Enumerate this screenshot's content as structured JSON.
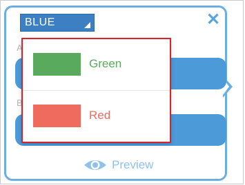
{
  "select": {
    "value": "BLUE"
  },
  "hidden_labels": {
    "first": "A",
    "second": "B"
  },
  "dropdown": {
    "options": [
      {
        "label": "Green",
        "swatch_color": "#5aaa5d",
        "text_color": "#5aaa5d"
      },
      {
        "label": "Red",
        "swatch_color": "#ee6b5e",
        "text_color": "#ee6b5e"
      }
    ]
  },
  "footer": {
    "preview_label": "Preview"
  },
  "colors": {
    "accent": "#3d7fc3",
    "card_border": "#6aaee3",
    "highlight_border": "#d9232a"
  },
  "icons": {
    "close": "close-icon",
    "dropdown_arrow": "dropdown-arrow-icon",
    "eye": "eye-icon"
  }
}
